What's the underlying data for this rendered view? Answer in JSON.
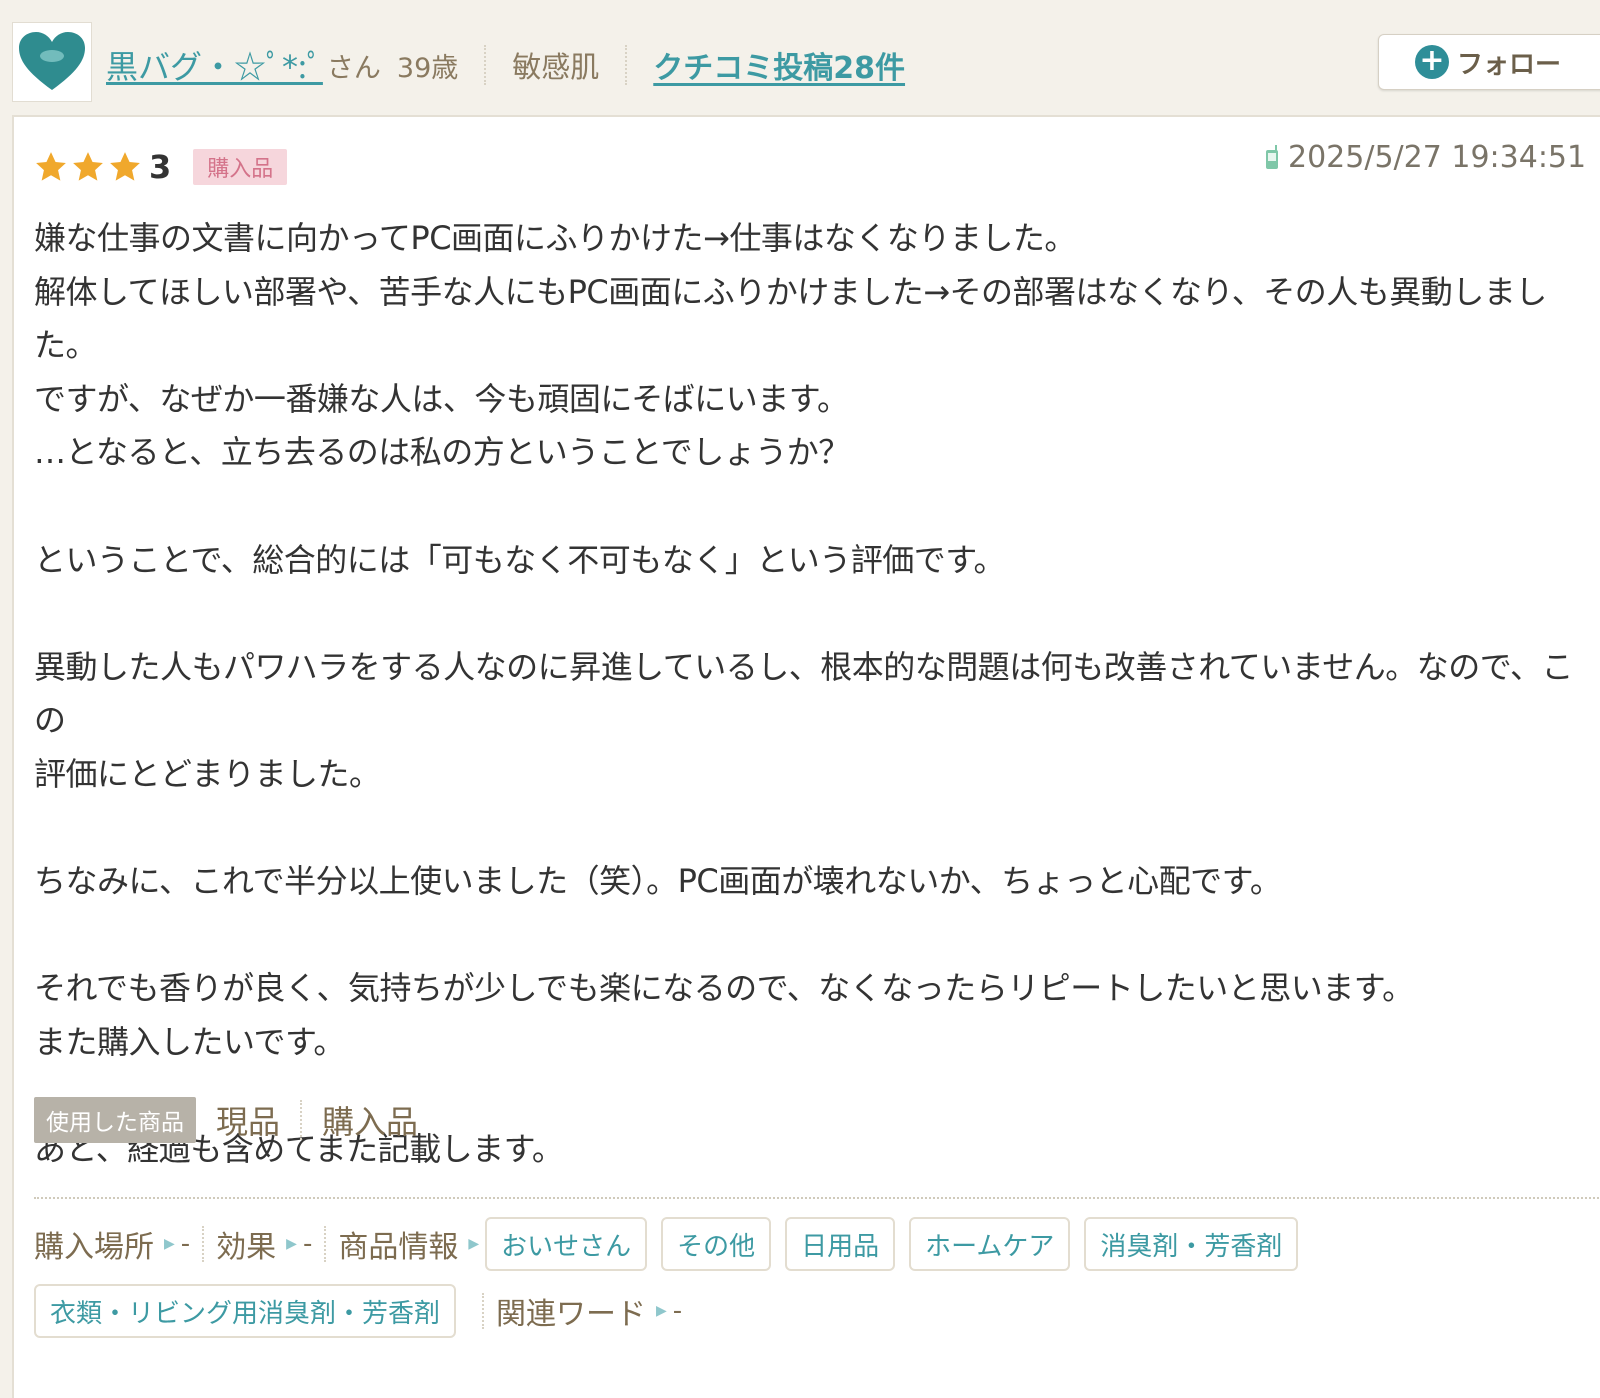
{
  "user": {
    "name": "黒バグ・☆ﾟ*:ﾟ",
    "suffix": "さん",
    "age": "39歳",
    "skin_type": "敏感肌",
    "review_count": "クチコミ投稿28件",
    "follow_label": "フォロー"
  },
  "review": {
    "rating": "3",
    "stars": 3,
    "badge": "購入品",
    "date": "2025/5/27 19:34:51",
    "body": "嫌な仕事の文書に向かってPC画面にふりかけた→仕事はなくなりました。\n解体してほしい部署や、苦手な人にもPC画面にふりかけました→その部署はなくなり、その人も異動しました。\nですが、なぜか一番嫌な人は、今も頑固にそばにいます。\n…となると、立ち去るのは私の方ということでしょうか？\n\nということで、総合的には「可もなく不可もなく」という評価です。\n\n異動した人もパワハラをする人なのに昇進しているし、根本的な問題は何も改善されていません。なので、この\n評価にとどまりました。\n\nちなみに、これで半分以上使いました（笑）。PC画面が壊れないか、ちょっと心配です。\n\nそれでも香りが良く、気持ちが少しでも楽になるので、なくなったらリピートしたいと思います。\nまた購入したいです。\n\nあと、経過も含めてまた記載します。"
  },
  "used_product": {
    "label": "使用した商品",
    "values": [
      "現品",
      "購入品"
    ]
  },
  "meta": {
    "purchase_place_label": "購入場所",
    "purchase_place_value": "-",
    "effect_label": "効果",
    "effect_value": "-",
    "product_info_label": "商品情報",
    "product_tags": [
      "おいせさん",
      "その他",
      "日用品",
      "ホームケア",
      "消臭剤・芳香剤",
      "衣類・リビング用消臭剤・芳香剤"
    ],
    "related_words_label": "関連ワード",
    "related_words_value": "-"
  },
  "colors": {
    "link": "#3d9aa3",
    "star": "#f0a82c",
    "badge_bg": "#f6d6dc",
    "badge_text": "#d4738a"
  }
}
